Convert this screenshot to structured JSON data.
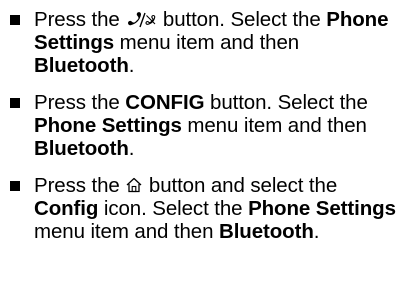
{
  "steps": [
    {
      "parts": [
        {
          "t": "Press the "
        },
        {
          "icon": "phone-mute-icon"
        },
        {
          "t": " button. Select the "
        },
        {
          "b": "Phone Settings"
        },
        {
          "t": " menu item and then "
        },
        {
          "b": "Bluetooth"
        },
        {
          "t": "."
        }
      ]
    },
    {
      "parts": [
        {
          "t": "Press the "
        },
        {
          "b": "CONFIG"
        },
        {
          "t": " button. Select the "
        },
        {
          "b": "Phone Settings"
        },
        {
          "t": " menu item and then "
        },
        {
          "b": "Bluetooth"
        },
        {
          "t": "."
        }
      ]
    },
    {
      "parts": [
        {
          "t": "Press the "
        },
        {
          "icon": "home-icon"
        },
        {
          "t": " button and select the "
        },
        {
          "b": "Config"
        },
        {
          "t": " icon. Select the "
        },
        {
          "b": "Phone Settings"
        },
        {
          "t": " menu item and then "
        },
        {
          "b": "Bluetooth"
        },
        {
          "t": "."
        }
      ]
    }
  ]
}
